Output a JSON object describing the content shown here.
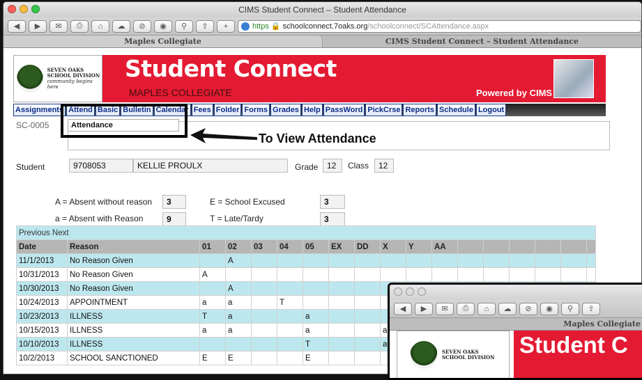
{
  "window": {
    "title": "CIMS Student Connect – Student Attendance",
    "url_https": "https",
    "url_host": "schoolconnect.7oaks.org",
    "url_path": "/schoolconnect/SCAttendance.aspx",
    "tab1": "Maples Collegiate",
    "tab2": "CIMS Student Connect – Student Attendance"
  },
  "banner": {
    "logo_line1": "SEVEN OAKS",
    "logo_line2": "SCHOOL DIVISION",
    "logo_line3": "community begins here",
    "title": "Student Connect",
    "school": "MAPLES COLLEGIATE",
    "powered": "Powered by CIMS"
  },
  "menu": [
    "Assignments",
    "Attend",
    "Basic",
    "Bulletin",
    "Calendar",
    "Fees",
    "Folder",
    "Forms",
    "Grades",
    "Help",
    "PassWord",
    "PickCrse",
    "Reports",
    "Schedule",
    "Logout"
  ],
  "dropdown_item": "Attendance",
  "callout": "To View Attendance",
  "sc_code": "SC-0005",
  "student": {
    "label": "Student",
    "id": "9708053",
    "name": "KELLIE PROULX",
    "grade_label": "Grade",
    "grade": "12",
    "class_label": "Class",
    "class": "12"
  },
  "legend": {
    "A_label": "A = Absent without reason",
    "A_count": "3",
    "a_label": "a = Absent with Reason",
    "a_count": "9",
    "E_label": "E = School Excused",
    "E_count": "3",
    "T_label": "T = Late/Tardy",
    "T_count": "3"
  },
  "table": {
    "prev_next": "Previous Next",
    "headers": [
      "Date",
      "Reason",
      "01",
      "02",
      "03",
      "04",
      "05",
      "EX",
      "DD",
      "X",
      "Y",
      "AA",
      "",
      "",
      "",
      "",
      "",
      ""
    ],
    "rows": [
      [
        "11/1/2013",
        "No Reason Given",
        "",
        "A",
        "",
        "",
        "",
        "",
        "",
        "",
        "",
        ""
      ],
      [
        "10/31/2013",
        "No Reason Given",
        "A",
        "",
        "",
        "",
        "",
        "",
        "",
        "",
        "",
        ""
      ],
      [
        "10/30/2013",
        "No Reason Given",
        "",
        "A",
        "",
        "",
        "",
        "",
        "",
        "",
        "",
        ""
      ],
      [
        "10/24/2013",
        "APPOINTMENT",
        "a",
        "a",
        "",
        "T",
        "",
        "",
        "",
        "",
        "",
        ""
      ],
      [
        "10/23/2013",
        "ILLNESS",
        "T",
        "a",
        "",
        "",
        "a",
        "",
        "",
        "",
        "",
        ""
      ],
      [
        "10/15/2013",
        "ILLNESS",
        "a",
        "a",
        "",
        "",
        "a",
        "",
        "",
        "a",
        "",
        ""
      ],
      [
        "10/10/2013",
        "ILLNESS",
        "",
        "",
        "",
        "",
        "T",
        "",
        "",
        "a",
        "",
        ""
      ],
      [
        "10/2/2013",
        "SCHOOL SANCTIONED",
        "E",
        "E",
        "",
        "",
        "E",
        "",
        "",
        "",
        "",
        ""
      ]
    ]
  },
  "window2": {
    "tab": "Maples Collegiate",
    "logo_line1": "SEVEN OAKS",
    "logo_line2": "SCHOOL DIVISION",
    "title": "Student C"
  }
}
